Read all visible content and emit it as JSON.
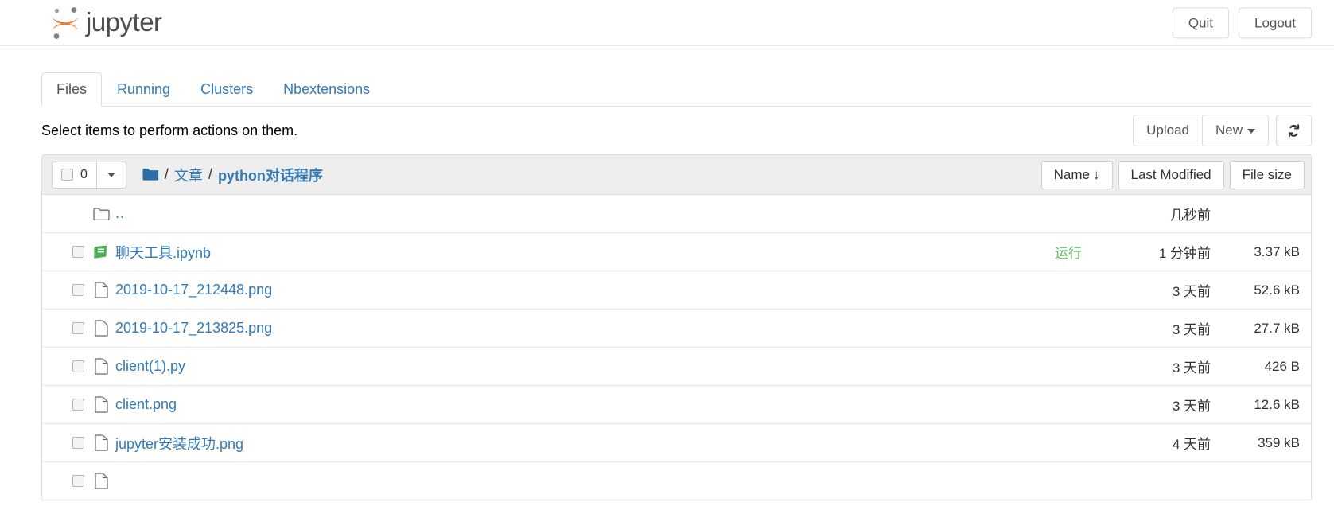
{
  "header": {
    "brand": "jupyter",
    "logo_icon": "jupyter-logo",
    "quit_label": "Quit",
    "logout_label": "Logout"
  },
  "tabs": [
    {
      "label": "Files",
      "active": true
    },
    {
      "label": "Running",
      "active": false
    },
    {
      "label": "Clusters",
      "active": false
    },
    {
      "label": "Nbextensions",
      "active": false
    }
  ],
  "toolbar": {
    "note": "Select items to perform actions on them.",
    "upload_label": "Upload",
    "new_label": "New",
    "new_caret_icon": "caret-down-icon",
    "refresh_icon": "refresh-icon"
  },
  "list_header": {
    "selected_count": "0",
    "select_checkbox_icon": "checkbox-icon",
    "select_caret_icon": "caret-down-icon",
    "folder_icon": "folder-icon",
    "breadcrumb": [
      {
        "label": "文章",
        "bold": false
      },
      {
        "label": "python对话程序",
        "bold": true
      }
    ],
    "separator": "/",
    "sort_name": "Name",
    "sort_name_arrow": "↓",
    "sort_modified": "Last Modified",
    "sort_filesize": "File size"
  },
  "rows": [
    {
      "name": "..",
      "icon": "folder-outline-icon",
      "has_checkbox": false,
      "status": "",
      "modified": "几秒前",
      "size": ""
    },
    {
      "name": "聊天工具.ipynb",
      "icon": "notebook-icon",
      "has_checkbox": true,
      "status": "运行",
      "modified": "1 分钟前",
      "size": "3.37 kB"
    },
    {
      "name": "2019-10-17_212448.png",
      "icon": "file-icon",
      "has_checkbox": true,
      "status": "",
      "modified": "3 天前",
      "size": "52.6 kB"
    },
    {
      "name": "2019-10-17_213825.png",
      "icon": "file-icon",
      "has_checkbox": true,
      "status": "",
      "modified": "3 天前",
      "size": "27.7 kB"
    },
    {
      "name": "client(1).py",
      "icon": "file-icon",
      "has_checkbox": true,
      "status": "",
      "modified": "3 天前",
      "size": "426 B"
    },
    {
      "name": "client.png",
      "icon": "file-icon",
      "has_checkbox": true,
      "status": "",
      "modified": "3 天前",
      "size": "12.6 kB"
    },
    {
      "name": "jupyter安装成功.png",
      "icon": "file-icon",
      "has_checkbox": true,
      "status": "",
      "modified": "4 天前",
      "size": "359 kB"
    },
    {
      "name": "",
      "icon": "file-icon",
      "has_checkbox": true,
      "status": "",
      "modified": "",
      "size": ""
    }
  ],
  "colors": {
    "link": "#337ab7",
    "brand_orange": "#f37726",
    "brand_gray": "#767677",
    "running_green": "#5cb85c",
    "notebook_green": "#4caf50"
  }
}
